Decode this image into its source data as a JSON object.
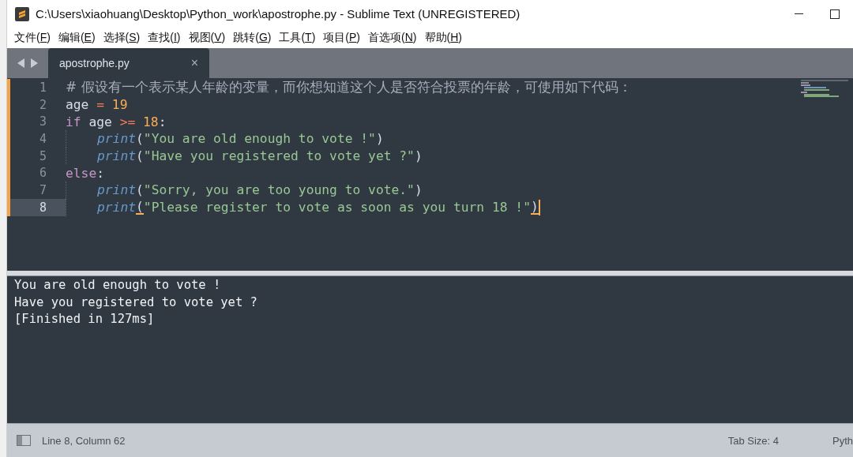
{
  "window": {
    "title": "C:\\Users\\xiaohuang\\Desktop\\Python_work\\apostrophe.py - Sublime Text (UNREGISTERED)"
  },
  "menu": [
    {
      "before": "文件(",
      "key": "F",
      "after": ")"
    },
    {
      "before": "编辑(",
      "key": "E",
      "after": ")"
    },
    {
      "before": "选择(",
      "key": "S",
      "after": ")"
    },
    {
      "before": "查找(",
      "key": "I",
      "after": ")"
    },
    {
      "before": "视图(",
      "key": "V",
      "after": ")"
    },
    {
      "before": "跳转(",
      "key": "G",
      "after": ")"
    },
    {
      "before": "工具(",
      "key": "T",
      "after": ")"
    },
    {
      "before": "项目(",
      "key": "P",
      "after": ")"
    },
    {
      "before": "首选项(",
      "key": "N",
      "after": ")"
    },
    {
      "before": "帮助(",
      "key": "H",
      "after": ")"
    }
  ],
  "tabs": [
    {
      "label": "apostrophe.py",
      "selected": true,
      "close": "×"
    }
  ],
  "editor": {
    "lines": [
      {
        "number": "1",
        "modified": true,
        "selected": false,
        "indent": false,
        "caret": false,
        "tokens": [
          {
            "kind": "comment",
            "text": "# 假设有一个表示某人年龄的变量，而你想知道这个人是否符合投票的年龄，可使用如下代码："
          }
        ]
      },
      {
        "number": "2",
        "modified": true,
        "selected": false,
        "indent": false,
        "caret": false,
        "tokens": [
          {
            "kind": "ident",
            "text": "age "
          },
          {
            "kind": "operator",
            "text": "="
          },
          {
            "kind": "number",
            "text": " 19"
          }
        ]
      },
      {
        "number": "3",
        "modified": true,
        "selected": false,
        "indent": false,
        "caret": false,
        "tokens": [
          {
            "kind": "keyword",
            "text": "if"
          },
          {
            "kind": "ident",
            "text": " age "
          },
          {
            "kind": "operator",
            "text": ">="
          },
          {
            "kind": "number",
            "text": " 18"
          },
          {
            "kind": "punct",
            "text": ":"
          }
        ]
      },
      {
        "number": "4",
        "modified": true,
        "selected": false,
        "indent": true,
        "caret": false,
        "tokens": [
          {
            "kind": "func",
            "text": "print"
          },
          {
            "kind": "punct",
            "text": "("
          },
          {
            "kind": "string",
            "text": "\"You are old enough to vote !\""
          },
          {
            "kind": "punct",
            "text": ")"
          }
        ]
      },
      {
        "number": "5",
        "modified": true,
        "selected": false,
        "indent": true,
        "caret": false,
        "tokens": [
          {
            "kind": "func",
            "text": "print"
          },
          {
            "kind": "punct",
            "text": "("
          },
          {
            "kind": "string",
            "text": "\"Have you registered to vote yet ?\""
          },
          {
            "kind": "punct",
            "text": ")"
          }
        ]
      },
      {
        "number": "6",
        "modified": true,
        "selected": false,
        "indent": false,
        "caret": false,
        "tokens": [
          {
            "kind": "keyword",
            "text": "else"
          },
          {
            "kind": "punct",
            "text": ":"
          }
        ]
      },
      {
        "number": "7",
        "modified": true,
        "selected": false,
        "indent": true,
        "caret": false,
        "tokens": [
          {
            "kind": "func",
            "text": "print"
          },
          {
            "kind": "punct",
            "text": "("
          },
          {
            "kind": "string",
            "text": "\"Sorry, you are too young to vote.\""
          },
          {
            "kind": "punct",
            "text": ")"
          }
        ]
      },
      {
        "number": "8",
        "modified": true,
        "selected": true,
        "indent": true,
        "caret": true,
        "tokens": [
          {
            "kind": "func",
            "text": "print"
          },
          {
            "kind": "bracket",
            "text": "("
          },
          {
            "kind": "string",
            "text": "\"Please register to vote as soon as you turn 18 !\""
          },
          {
            "kind": "bracket",
            "text": ")"
          }
        ]
      }
    ]
  },
  "output": {
    "lines": [
      "You are old enough to vote !",
      "Have you registered to vote yet ?",
      "[Finished in 127ms]"
    ]
  },
  "status_bar": {
    "position": "Line 8, Column 62",
    "tab_size": "Tab Size: 4",
    "syntax": "Pyth"
  }
}
